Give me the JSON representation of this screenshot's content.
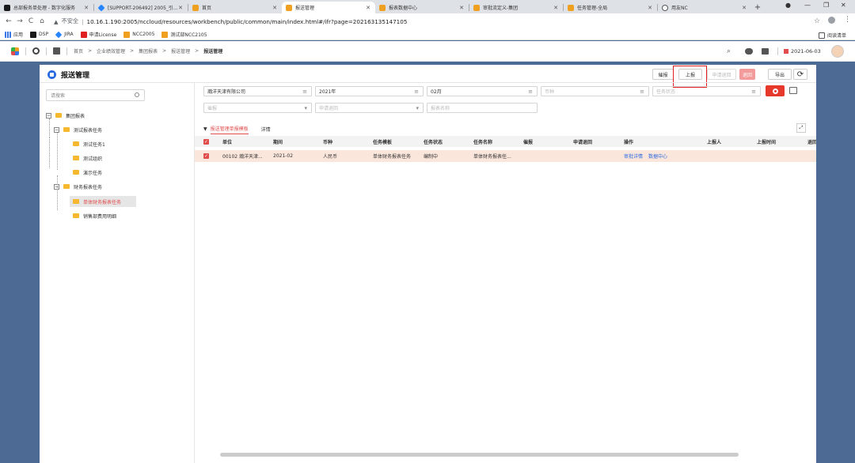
{
  "browser": {
    "tabs": [
      {
        "label": "总部报务单处理 - 数字化服务",
        "icon": "ds-icon",
        "color": "#1a1a1a",
        "active": false
      },
      {
        "label": "[SUPPORT-206492] 2005_引...",
        "icon": "jira-icon",
        "color": "#2684ff",
        "active": false
      },
      {
        "label": "首页",
        "icon": "ncc-icon",
        "color": "#f0a020",
        "active": false
      },
      {
        "label": "报送管理",
        "icon": "ncc-icon",
        "color": "#f0a020",
        "active": true
      },
      {
        "label": "报表数据中心",
        "icon": "ncc-icon",
        "color": "#f0a020",
        "active": false
      },
      {
        "label": "审批流定义-集团",
        "icon": "ncc-icon",
        "color": "#f0a020",
        "active": false
      },
      {
        "label": "任务管理-全局",
        "icon": "ncc-icon",
        "color": "#f0a020",
        "active": false
      },
      {
        "label": "用友NC",
        "icon": "globe-icon",
        "color": "#555555",
        "active": false
      }
    ],
    "url_warning": "不安全",
    "url": "10.16.1.190:2005/nccloud/resources/workbench/public/common/main/index.html#/ifr?page=20216313514710​5",
    "bookmarks": [
      "应用",
      "DSP",
      "JIRA",
      "申请License",
      "NCC2005",
      "测试部NCC2105"
    ],
    "reading_list": "阅读清单"
  },
  "app_header": {
    "breadcrumb": [
      "首页",
      "企业绩效管理",
      "集团报表",
      "报送管理",
      "报送管理"
    ],
    "date": "2021-06-03"
  },
  "page": {
    "title": "报送管理",
    "buttons": {
      "urge": "催报",
      "report": "上报",
      "request_return": "申请退回",
      "return": "退回",
      "export": "导出"
    }
  },
  "tree": {
    "search_placeholder": "请搜索",
    "root": "集团报表",
    "group1": "测试报表任务",
    "g1_items": [
      "测试任务1",
      "测试组织",
      "演示任务"
    ],
    "group2": "财务报表任务",
    "g2_items": [
      "单体财务报表任务",
      "销售部费用明细"
    ]
  },
  "filters": {
    "company": "瀚洋天津有限公司",
    "year": "2021年",
    "month": "02月",
    "currency_ph": "币种",
    "task_status_ph": "任务状态",
    "urge_ph": "催报",
    "request_return_ph": "申请退回",
    "report_name_ph": "报表名称"
  },
  "sub_tabs": [
    "报送管理单报模板",
    "详情"
  ],
  "table": {
    "headers": [
      "单位",
      "期间",
      "币种",
      "任务模板",
      "任务状态",
      "任务名称",
      "催报",
      "申请退回",
      "操作",
      "上报人",
      "上报时间",
      "退回"
    ],
    "rows": [
      {
        "unit": "00102 瀚洋天津...",
        "period": "2021-02",
        "currency": "人民币",
        "template": "单体财务报表任务",
        "status": "编制中",
        "task_name": "单体财务报表任...",
        "urge": "",
        "request_return": "",
        "ops": [
          "审批详情",
          "数据中心"
        ],
        "reporter": "",
        "report_time": ""
      }
    ]
  },
  "colors": {
    "accent_red": "#e14c4c",
    "link_blue": "#2a6ae0",
    "bg_blue": "#4d6a94"
  }
}
